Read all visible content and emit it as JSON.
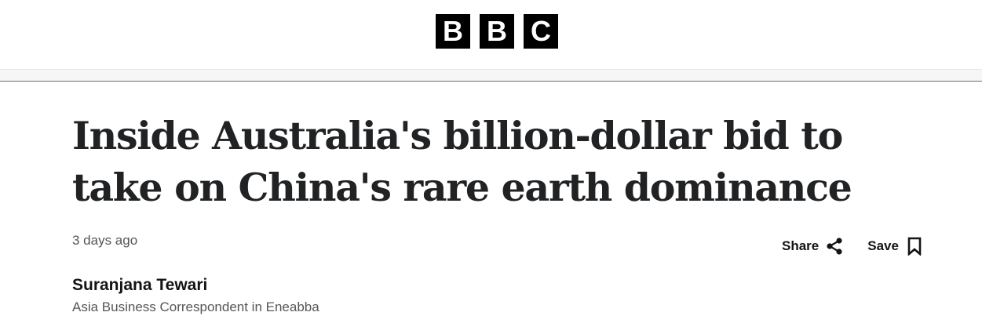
{
  "header": {
    "logo_letters": [
      "B",
      "B",
      "C"
    ]
  },
  "article": {
    "headline_line1": "Inside Australia's billion-dollar bid to",
    "headline_line2": "take on China's rare earth dominance",
    "timestamp": "3 days ago",
    "author_name": "Suranjana Tewari",
    "author_role": "Asia Business Correspondent in Eneabba"
  },
  "actions": {
    "share_label": "Share",
    "share_icon": "share-icon",
    "save_label": "Save",
    "save_icon": "bookmark-icon"
  },
  "colors": {
    "logo_block": "#000000",
    "headline": "#202224",
    "secondary_text": "#545658",
    "nav_strip": "#f6f6f6"
  }
}
